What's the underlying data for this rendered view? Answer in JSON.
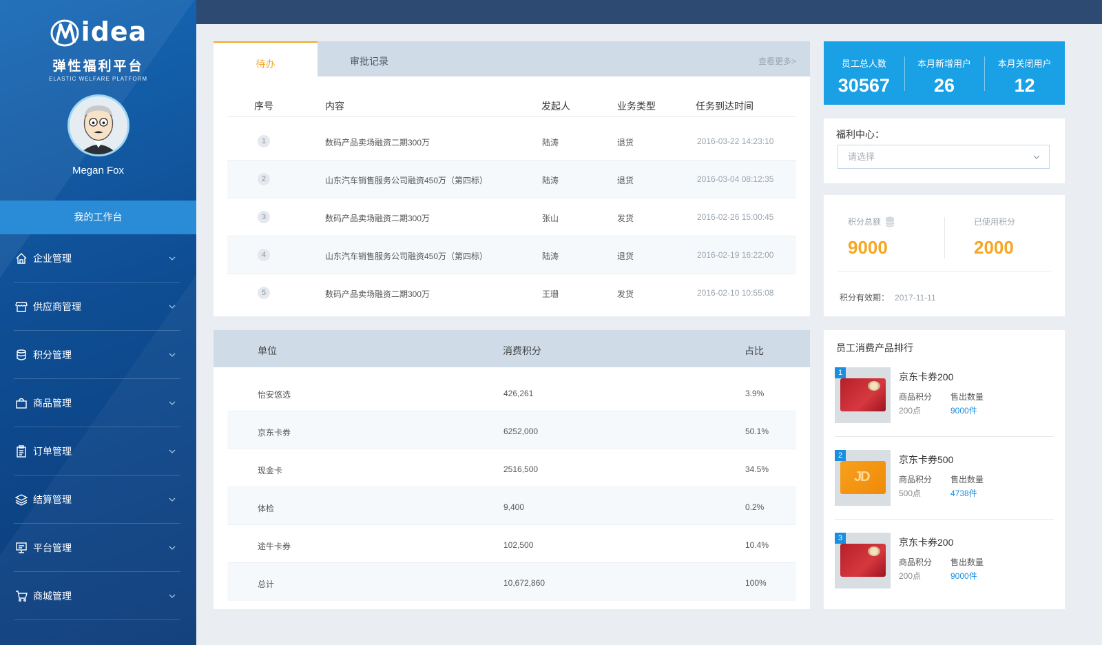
{
  "brand": {
    "logo_text": "idea",
    "platform_name": "弹性福利平台",
    "platform_name_en": "ELASTIC WELFARE PLATFORM"
  },
  "user": {
    "name": "Megan Fox"
  },
  "sidebar": {
    "workbench_label": "我的工作台",
    "items": [
      {
        "label": "企业管理",
        "icon": "home-icon"
      },
      {
        "label": "供应商管理",
        "icon": "store-icon"
      },
      {
        "label": "积分管理",
        "icon": "database-icon"
      },
      {
        "label": "商品管理",
        "icon": "bag-icon"
      },
      {
        "label": "订单管理",
        "icon": "clipboard-icon"
      },
      {
        "label": "结算管理",
        "icon": "layers-icon"
      },
      {
        "label": "平台管理",
        "icon": "monitor-icon"
      },
      {
        "label": "商城管理",
        "icon": "cart-icon"
      }
    ]
  },
  "todo": {
    "tabs": [
      "待办",
      "审批记录"
    ],
    "more": "查看更多>",
    "headers": [
      "序号",
      "内容",
      "发起人",
      "业务类型",
      "任务到达时间"
    ],
    "rows": [
      {
        "no": "1",
        "content": "数码产品卖场融资二期300万",
        "initiator": "陆涛",
        "type": "退货",
        "time": "2016-03-22 14:23:10"
      },
      {
        "no": "2",
        "content": "山东汽车销售服务公司融资450万（第四标）",
        "initiator": "陆涛",
        "type": "退货",
        "time": "2016-03-04 08:12:35"
      },
      {
        "no": "3",
        "content": "数码产品卖场融资二期300万",
        "initiator": "张山",
        "type": "发货",
        "time": "2016-02-26 15:00:45"
      },
      {
        "no": "4",
        "content": "山东汽车销售服务公司融资450万（第四标）",
        "initiator": "陆涛",
        "type": "退货",
        "time": "2016-02-19 16:22:00"
      },
      {
        "no": "5",
        "content": "数码产品卖场融资二期300万",
        "initiator": "王珊",
        "type": "发货",
        "time": "2016-02-10 10:55:08"
      }
    ]
  },
  "consume": {
    "headers": [
      "单位",
      "消费积分",
      "占比"
    ],
    "rows": [
      {
        "unit": "怡安悠选",
        "points": "426,261",
        "ratio": "3.9%"
      },
      {
        "unit": "京东卡券",
        "points": "6252,000",
        "ratio": "50.1%"
      },
      {
        "unit": "现金卡",
        "points": "2516,500",
        "ratio": "34.5%"
      },
      {
        "unit": "体检",
        "points": "9,400",
        "ratio": "0.2%"
      },
      {
        "unit": "途牛卡券",
        "points": "102,500",
        "ratio": "10.4%"
      },
      {
        "unit": "总计",
        "points": "10,672,860",
        "ratio": "100%"
      }
    ]
  },
  "stats": [
    {
      "label": "员工总人数",
      "value": "30567"
    },
    {
      "label": "本月新增用户",
      "value": "26"
    },
    {
      "label": "本月关闭用户",
      "value": "12"
    }
  ],
  "welfare": {
    "label": "福利中心：",
    "placeholder": "请选择"
  },
  "points": {
    "total_label": "积分总额",
    "total_value": "9000",
    "used_label": "已使用积分",
    "used_value": "2000",
    "valid_label": "积分有效期：",
    "valid_value": "2017-11-11"
  },
  "ranking": {
    "title": "员工消费产品排行",
    "key_points": "商品积分",
    "key_sold": "售出数量",
    "items": [
      {
        "rank": "1",
        "name": "京东卡券200",
        "points": "200点",
        "sold": "9000件"
      },
      {
        "rank": "2",
        "name": "京东卡券500",
        "points": "500点",
        "sold": "4738件"
      },
      {
        "rank": "3",
        "name": "京东卡券200",
        "points": "200点",
        "sold": "9000件"
      }
    ]
  },
  "colors": {
    "accent": "#f5a623",
    "primary": "#1aa0e4",
    "topbar": "#2d4a72",
    "sidebar": "#0f4e94"
  }
}
